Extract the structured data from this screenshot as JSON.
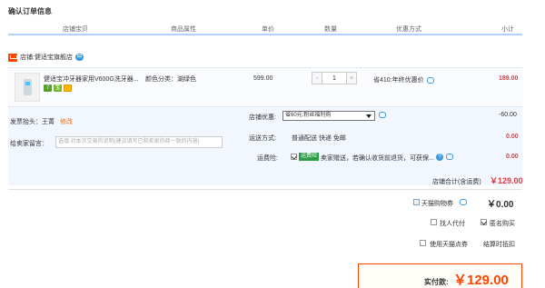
{
  "page": {
    "title": "确认订单信息"
  },
  "columns": [
    "店铺宝贝",
    "商品属性",
    "单价",
    "数量",
    "优惠方式",
    "小计"
  ],
  "shop": {
    "prefix": "店铺:",
    "name": "健适宝旗舰店"
  },
  "item": {
    "title": "健适宝冲牙器家用V600G洗牙器...",
    "attr": "颜色分类：湖绿色",
    "badges": [
      "7",
      "宝",
      "卡"
    ],
    "unit_price": "599.00",
    "quantity": "1",
    "minus": "-",
    "plus": "+",
    "promo": "省410:年终优惠价",
    "subtotal": "189.00"
  },
  "options": {
    "invoice_label": "发票抬头：",
    "invoice_value": "王菁",
    "edit_link": "修改",
    "memo_label": "给卖家留言：",
    "memo_placeholder": "选填:对本次交易的说明(建议填写已和卖家协商一致的内容)",
    "shop_discount_label": "店铺优惠:",
    "shop_discount_value": "省60元:粉丝福利购",
    "discount_amount": "-60.00",
    "shipping_label": "运送方式:",
    "shipping_value": "普通配送 快递 免邮",
    "shipping_amount": "0.00",
    "insurance_label": "运费险:",
    "insurance_badge": "运费险",
    "insurance_text": "卖家赠送，若确认收货前退货，可获保...",
    "insurance_amount": "0.00",
    "help": "?",
    "store_total_label": "店铺合计(含运费)",
    "store_total_value": "￥129.00"
  },
  "summary": {
    "coupon_label": "天猫购物券",
    "coupon_value": "￥0.00",
    "proxy_pay_label": "找人代付",
    "anonymous_label": "匿名购买",
    "points_label": "使用天猫点券",
    "points_value": "结算时抵扣",
    "pay_label": "实付款:",
    "pay_value": "￥129.00"
  },
  "colors": {
    "accent": "#ff4400",
    "price_red": "#e4393c",
    "link_blue": "#3c9ae0",
    "header_line": "#b2d1ff",
    "options_bg": "#f2f7ff"
  }
}
